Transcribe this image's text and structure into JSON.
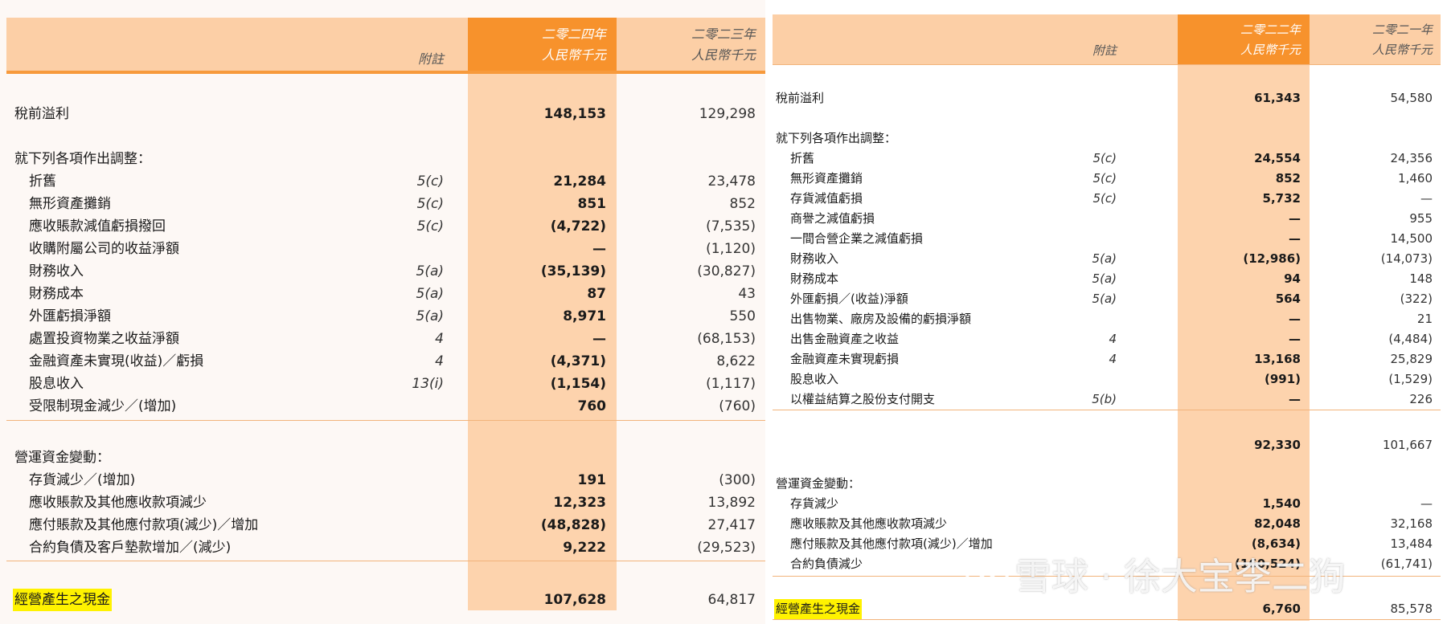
{
  "left": {
    "header": {
      "note": "附註",
      "col1_year": "二零二四年",
      "col1_unit": "人民幣千元",
      "col2_year": "二零二三年",
      "col2_unit": "人民幣千元"
    },
    "rows": [
      {
        "label": "稅前溢利",
        "note": "",
        "v1": "148,153",
        "v2": "129,298"
      },
      {
        "label": "就下列各項作出調整：",
        "note": "",
        "v1": "",
        "v2": ""
      },
      {
        "label": "折舊",
        "note": "5(c)",
        "v1": "21,284",
        "v2": "23,478"
      },
      {
        "label": "無形資產攤銷",
        "note": "5(c)",
        "v1": "851",
        "v2": "852"
      },
      {
        "label": "應收賬款減值虧損撥回",
        "note": "5(c)",
        "v1": "(4,722)",
        "v2": "(7,535)"
      },
      {
        "label": "收購附屬公司的收益淨額",
        "note": "",
        "v1": "—",
        "v2": "(1,120)"
      },
      {
        "label": "財務收入",
        "note": "5(a)",
        "v1": "(35,139)",
        "v2": "(30,827)"
      },
      {
        "label": "財務成本",
        "note": "5(a)",
        "v1": "87",
        "v2": "43"
      },
      {
        "label": "外匯虧損淨額",
        "note": "5(a)",
        "v1": "8,971",
        "v2": "550"
      },
      {
        "label": "處置投資物業之收益淨額",
        "note": "4",
        "v1": "—",
        "v2": "(68,153)"
      },
      {
        "label": "金融資產未實現(收益)／虧損",
        "note": "4",
        "v1": "(4,371)",
        "v2": "8,622"
      },
      {
        "label": "股息收入",
        "note": "13(i)",
        "v1": "(1,154)",
        "v2": "(1,117)"
      },
      {
        "label": "受限制現金減少／(增加)",
        "note": "",
        "v1": "760",
        "v2": "(760)"
      },
      {
        "label": "營運資金變動：",
        "note": "",
        "v1": "",
        "v2": ""
      },
      {
        "label": "存貨減少／(增加)",
        "note": "",
        "v1": "191",
        "v2": "(300)"
      },
      {
        "label": "應收賬款及其他應收款項減少",
        "note": "",
        "v1": "12,323",
        "v2": "13,892"
      },
      {
        "label": "應付賬款及其他應付款項(減少)／增加",
        "note": "",
        "v1": "(48,828)",
        "v2": "27,417"
      },
      {
        "label": "合約負債及客戶墊款增加／(減少)",
        "note": "",
        "v1": "9,222",
        "v2": "(29,523)"
      },
      {
        "label": "經營產生之現金",
        "note": "",
        "v1": "107,628",
        "v2": "64,817"
      }
    ]
  },
  "right": {
    "header": {
      "note": "附註",
      "col1_year": "二零二二年",
      "col1_unit": "人民幣千元",
      "col2_year": "二零二一年",
      "col2_unit": "人民幣千元"
    },
    "rows": [
      {
        "label": "稅前溢利",
        "note": "",
        "v1": "61,343",
        "v2": "54,580"
      },
      {
        "label": "就下列各項作出調整：",
        "note": "",
        "v1": "",
        "v2": ""
      },
      {
        "label": "折舊",
        "note": "5(c)",
        "v1": "24,554",
        "v2": "24,356"
      },
      {
        "label": "無形資產攤銷",
        "note": "5(c)",
        "v1": "852",
        "v2": "1,460"
      },
      {
        "label": "存貨減值虧損",
        "note": "5(c)",
        "v1": "5,732",
        "v2": "—"
      },
      {
        "label": "商譽之減值虧損",
        "note": "",
        "v1": "—",
        "v2": "955"
      },
      {
        "label": "一間合營企業之減值虧損",
        "note": "",
        "v1": "—",
        "v2": "14,500"
      },
      {
        "label": "財務收入",
        "note": "5(a)",
        "v1": "(12,986)",
        "v2": "(14,073)"
      },
      {
        "label": "財務成本",
        "note": "5(a)",
        "v1": "94",
        "v2": "148"
      },
      {
        "label": "外匯虧損／(收益)淨額",
        "note": "5(a)",
        "v1": "564",
        "v2": "(322)"
      },
      {
        "label": "出售物業、廠房及設備的虧損淨額",
        "note": "",
        "v1": "—",
        "v2": "21"
      },
      {
        "label": "出售金融資產之收益",
        "note": "4",
        "v1": "—",
        "v2": "(4,484)"
      },
      {
        "label": "金融資產未實現虧損",
        "note": "4",
        "v1": "13,168",
        "v2": "25,829"
      },
      {
        "label": "股息收入",
        "note": "",
        "v1": "(991)",
        "v2": "(1,529)"
      },
      {
        "label": "以權益結算之股份支付開支",
        "note": "5(b)",
        "v1": "—",
        "v2": "226"
      },
      {
        "label": "",
        "note": "",
        "v1": "92,330",
        "v2": "101,667"
      },
      {
        "label": "營運資金變動：",
        "note": "",
        "v1": "",
        "v2": ""
      },
      {
        "label": "存貨減少",
        "note": "",
        "v1": "1,540",
        "v2": "—"
      },
      {
        "label": "應收賬款及其他應收款項減少",
        "note": "",
        "v1": "82,048",
        "v2": "32,168"
      },
      {
        "label": "應付賬款及其他應付款項(減少)／增加",
        "note": "",
        "v1": "(8,634)",
        "v2": "13,484"
      },
      {
        "label": "合約負債減少",
        "note": "",
        "v1": "(160,524)",
        "v2": "(61,741)"
      },
      {
        "label": "經營產生之現金",
        "note": "",
        "v1": "6,760",
        "v2": "85,578"
      }
    ]
  },
  "watermark": {
    "text": "雪球 · 徐大宝李二狗",
    "logo": "xueqiu-logo-icon"
  }
}
